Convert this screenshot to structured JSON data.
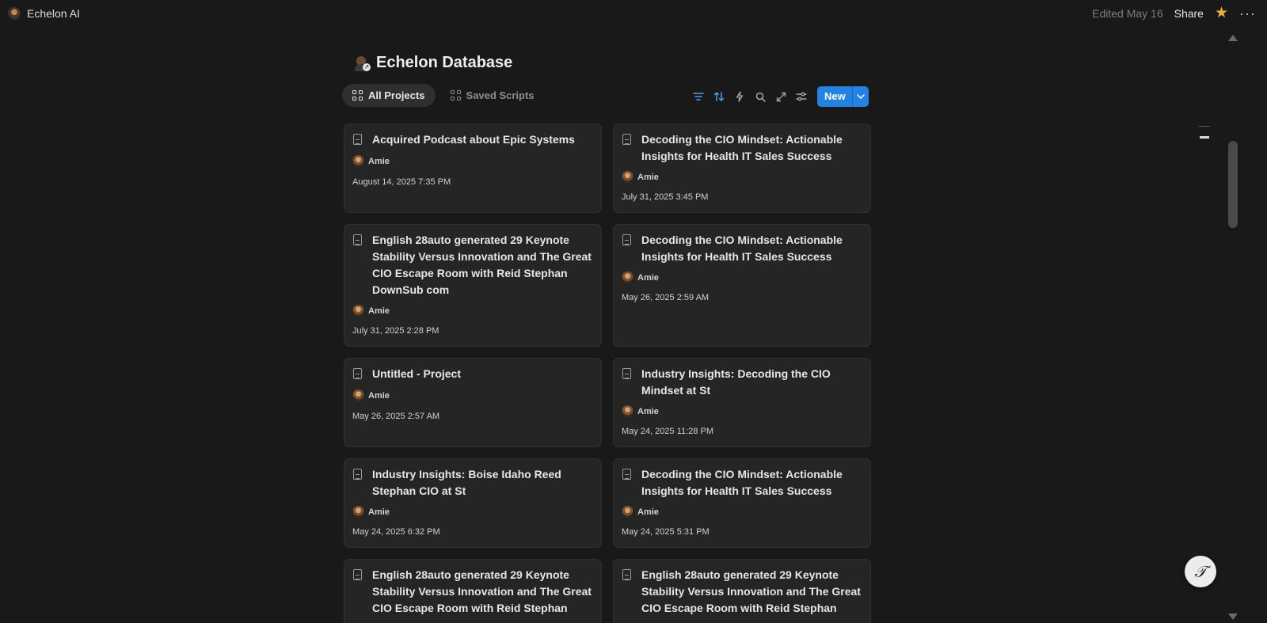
{
  "topbar": {
    "workspace_name": "Echelon AI",
    "edited": "Edited May 16",
    "share_label": "Share",
    "star_icon": "★",
    "more_icon": "···"
  },
  "page": {
    "title": "Echelon Database"
  },
  "tabs": [
    {
      "label": "All Projects",
      "active": true
    },
    {
      "label": "Saved Scripts",
      "active": false
    }
  ],
  "toolbar": {
    "new_label": "New",
    "accent_color": "#2383e2"
  },
  "cards": [
    {
      "title": "Acquired Podcast about Epic Systems",
      "person": "Amie",
      "date": "August 14, 2025 7:35 PM"
    },
    {
      "title": "Decoding the CIO Mindset: Actionable Insights for Health IT Sales Success",
      "person": "Amie",
      "date": "July 31, 2025 3:45 PM"
    },
    {
      "title": "English 28auto generated 29 Keynote Stability Versus Innovation and The Great CIO Escape Room with Reid Stephan DownSub com",
      "person": "Amie",
      "date": "July 31, 2025 2:28 PM"
    },
    {
      "title": "Decoding the CIO Mindset: Actionable Insights for Health IT Sales Success",
      "person": "Amie",
      "date": "May 26, 2025 2:59 AM"
    },
    {
      "title": "Untitled - Project",
      "person": "Amie",
      "date": "May 26, 2025 2:57 AM"
    },
    {
      "title": "Industry Insights: Decoding the CIO Mindset at St",
      "person": "Amie",
      "date": "May 24, 2025 11:28 PM"
    },
    {
      "title": "Industry Insights: Boise Idaho Reed Stephan CIO at St",
      "person": "Amie",
      "date": "May 24, 2025 6:32 PM"
    },
    {
      "title": "Decoding the CIO Mindset: Actionable Insights for Health IT Sales Success",
      "person": "Amie",
      "date": "May 24, 2025 5:31 PM"
    },
    {
      "title": "English 28auto generated 29 Keynote Stability Versus Innovation and The Great CIO Escape Room with Reid Stephan",
      "person": "",
      "date": ""
    },
    {
      "title": "English 28auto generated 29 Keynote Stability Versus Innovation and The Great CIO Escape Room with Reid Stephan",
      "person": "",
      "date": ""
    }
  ],
  "help_icon": "𝒯"
}
